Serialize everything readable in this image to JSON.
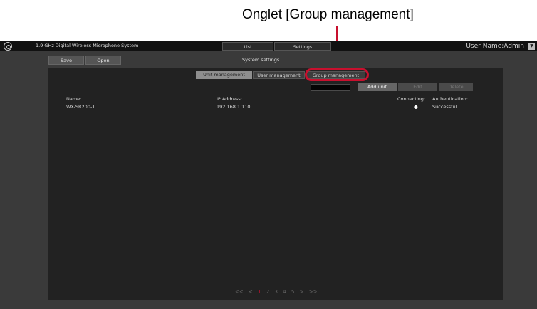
{
  "callout": {
    "text": "Onglet [Group management]"
  },
  "header": {
    "app_title": "1.9 GHz Digital Wireless Microphone System",
    "nav_tabs": [
      "List",
      "Settings"
    ],
    "user_label": "User Name:Admin"
  },
  "toolbar": {
    "save": "Save",
    "open": "Open",
    "heading": "System settings"
  },
  "tabs": [
    "Unit management",
    "User management",
    "Group management"
  ],
  "actions": {
    "add": "Add unit",
    "edit": "Edit",
    "delete": "Delete"
  },
  "columns": {
    "name": "Name:",
    "ip": "IP Address:",
    "connecting": "Connecting:",
    "auth": "Authentication:"
  },
  "rows": [
    {
      "name": "WX-SR200-1",
      "ip": "192.168.1.110",
      "connecting": "●",
      "auth": "Successful"
    }
  ],
  "pager": {
    "first": "<<",
    "prev": "<",
    "pages": [
      "1",
      "2",
      "3",
      "4",
      "5"
    ],
    "current": "1",
    "next": ">",
    "last": ">>"
  },
  "colors": {
    "accent": "#c8102e",
    "panel": "#222222",
    "background": "#3a3a3a"
  }
}
